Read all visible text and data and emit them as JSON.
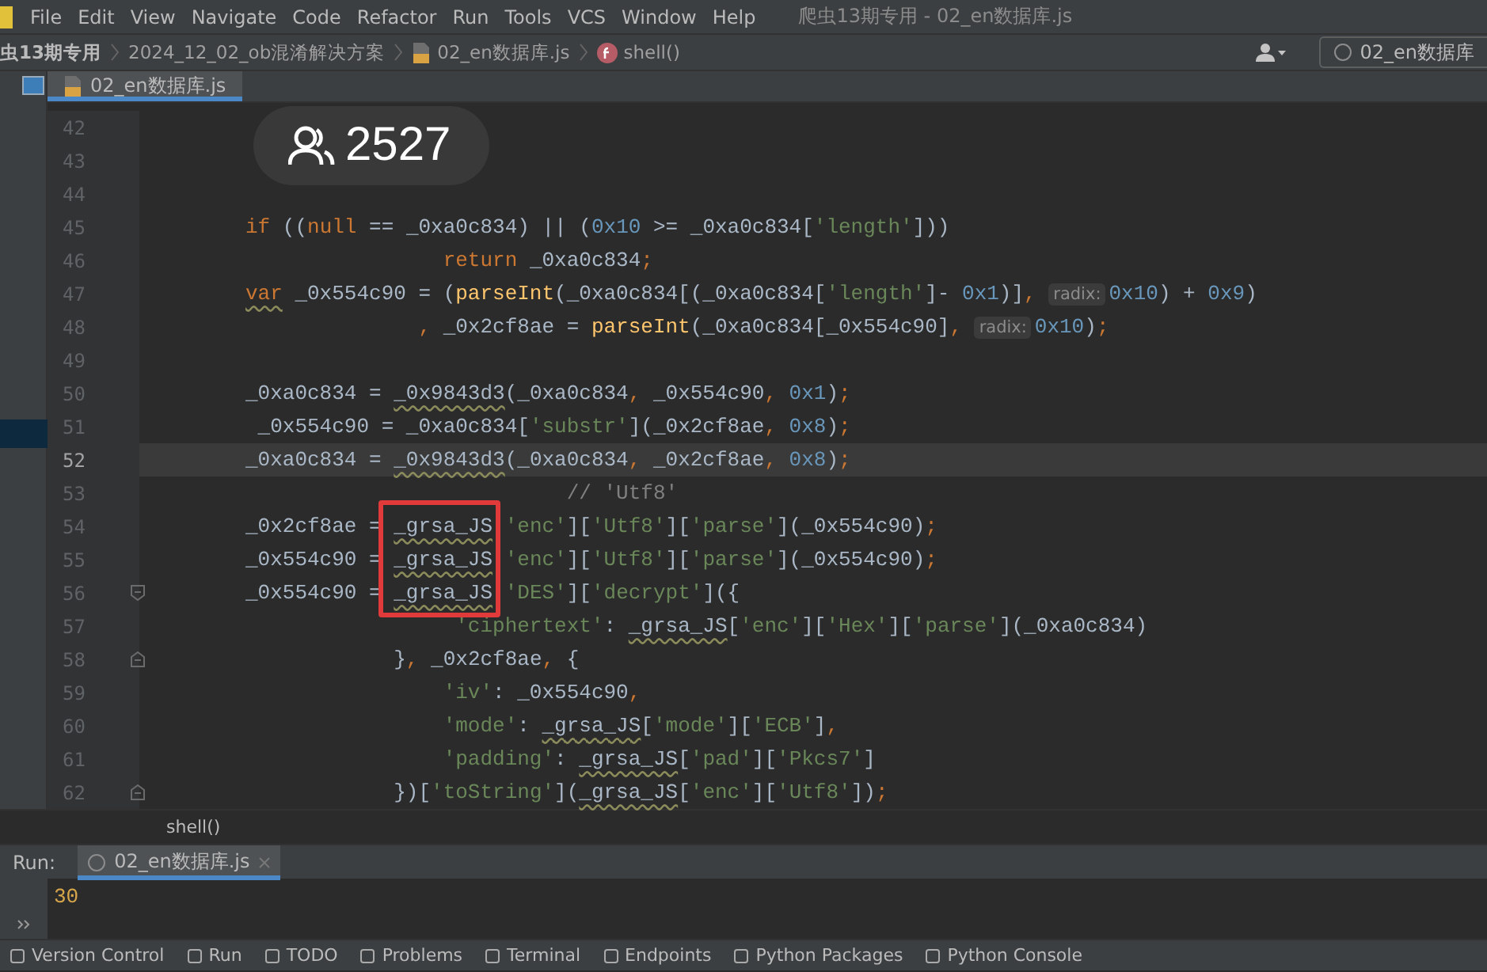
{
  "menu_bar": {
    "items": [
      "File",
      "Edit",
      "View",
      "Navigate",
      "Code",
      "Refactor",
      "Run",
      "Tools",
      "VCS",
      "Window",
      "Help"
    ],
    "title": "爬虫13期专用 - 02_en数据库.js"
  },
  "breadcrumbs": [
    {
      "kind": "project",
      "text": "虫13期专用"
    },
    {
      "kind": "folder",
      "text": "2024_12_02_ob混淆解决方案"
    },
    {
      "kind": "file",
      "text": "02_en数据库.js"
    },
    {
      "kind": "function",
      "text": "shell()"
    }
  ],
  "run_config": {
    "label": "02_en数据库"
  },
  "editor_tabs": [
    {
      "label": "02_en数据库.js",
      "selected": true
    }
  ],
  "viewer_badge": {
    "count": "2527"
  },
  "lines": [
    {
      "number": "42",
      "kind": "code",
      "current": false
    },
    {
      "number": "43",
      "kind": "code",
      "current": false
    },
    {
      "number": "44",
      "kind": "code",
      "current": false
    },
    {
      "number": "45",
      "kind": "code",
      "current": false,
      "tokens": [
        {
          "kind": "keyword",
          "text": "if"
        },
        {
          "kind": "plain",
          "text": " (("
        },
        {
          "kind": "keyword",
          "text": "null"
        },
        {
          "kind": "plain",
          "text": " == _0xa0c834) || ("
        },
        {
          "kind": "number",
          "text": "0x10"
        },
        {
          "kind": "plain",
          "text": " >= _0xa0c834["
        },
        {
          "kind": "string",
          "text": "'length'"
        },
        {
          "kind": "plain",
          "text": "]))"
        }
      ]
    },
    {
      "number": "46",
      "kind": "code",
      "current": false,
      "tokens": [
        {
          "kind": "keyword",
          "text": "                return"
        },
        {
          "kind": "plain",
          "text": " _0xa0c834"
        },
        {
          "kind": "punct",
          "text": ";"
        }
      ]
    },
    {
      "number": "47",
      "kind": "code",
      "current": false,
      "tokens": [
        {
          "kind": "keyword-warn",
          "text": "var"
        },
        {
          "kind": "plain",
          "text": " _0x554c90 = ("
        },
        {
          "kind": "function",
          "text": "parseInt"
        },
        {
          "kind": "plain",
          "text": "(_0xa0c834[(_0xa0c834["
        },
        {
          "kind": "string",
          "text": "'length'"
        },
        {
          "kind": "plain",
          "text": "]- "
        },
        {
          "kind": "number",
          "text": "0x1"
        },
        {
          "kind": "plain",
          "text": ")]"
        },
        {
          "kind": "punct",
          "text": ", "
        },
        {
          "kind": "hint",
          "text": "radix:"
        },
        {
          "kind": "number",
          "text": "0x10"
        },
        {
          "kind": "plain",
          "text": ") + "
        },
        {
          "kind": "number",
          "text": "0x9"
        },
        {
          "kind": "plain",
          "text": ")"
        }
      ]
    },
    {
      "number": "48",
      "kind": "code",
      "current": false,
      "tokens": [
        {
          "kind": "punct",
          "text": "              ,"
        },
        {
          "kind": "plain",
          "text": " _0x2cf8ae = "
        },
        {
          "kind": "function",
          "text": "parseInt"
        },
        {
          "kind": "plain",
          "text": "(_0xa0c834[_0x554c90]"
        },
        {
          "kind": "punct",
          "text": ", "
        },
        {
          "kind": "hint",
          "text": "radix:"
        },
        {
          "kind": "number",
          "text": "0x10"
        },
        {
          "kind": "plain",
          "text": ")"
        },
        {
          "kind": "punct",
          "text": ";"
        }
      ]
    },
    {
      "number": "49",
      "kind": "code",
      "current": false
    },
    {
      "number": "50",
      "kind": "code",
      "current": false,
      "tokens": [
        {
          "kind": "plain",
          "text": "_0xa0c834 = "
        },
        {
          "kind": "warn",
          "text": "_0x9843d3"
        },
        {
          "kind": "plain",
          "text": "(_0xa0c834"
        },
        {
          "kind": "punct",
          "text": ","
        },
        {
          "kind": "plain",
          "text": " _0x554c90"
        },
        {
          "kind": "punct",
          "text": ","
        },
        {
          "kind": "number",
          "text": " 0x1"
        },
        {
          "kind": "plain",
          "text": ")"
        },
        {
          "kind": "punct",
          "text": ";"
        }
      ]
    },
    {
      "number": "51",
      "kind": "code",
      "current": false,
      "tokens": [
        {
          "kind": "plain",
          "text": " _0x554c90 = _0xa0c834["
        },
        {
          "kind": "string",
          "text": "'substr'"
        },
        {
          "kind": "plain",
          "text": "](_0x2cf8ae"
        },
        {
          "kind": "punct",
          "text": ","
        },
        {
          "kind": "number",
          "text": " 0x8"
        },
        {
          "kind": "plain",
          "text": ")"
        },
        {
          "kind": "punct",
          "text": ";"
        }
      ]
    },
    {
      "number": "52",
      "kind": "code",
      "current": true,
      "tokens": [
        {
          "kind": "plain",
          "text": "_0xa0c834 = "
        },
        {
          "kind": "warn",
          "text": "_0x9843d3"
        },
        {
          "kind": "plain",
          "text": "(_0xa0c834"
        },
        {
          "kind": "punct",
          "text": ","
        },
        {
          "kind": "plain",
          "text": " _0x2cf8ae"
        },
        {
          "kind": "punct",
          "text": ","
        },
        {
          "kind": "number",
          "text": " 0x8"
        },
        {
          "kind": "plain",
          "text": ")"
        },
        {
          "kind": "punct",
          "text": ";"
        }
      ]
    },
    {
      "number": "53",
      "kind": "code",
      "current": false,
      "tokens": [
        {
          "kind": "comment",
          "text": "                          // 'Utf8'"
        }
      ]
    },
    {
      "number": "54",
      "kind": "code",
      "current": false,
      "tokens": [
        {
          "kind": "plain",
          "text": "_0x2cf8ae = "
        },
        {
          "kind": "warn",
          "text": "_grsa_JS"
        },
        {
          "kind": "string",
          "text": " 'enc'"
        },
        {
          "kind": "plain",
          "text": "]["
        },
        {
          "kind": "string",
          "text": "'Utf8'"
        },
        {
          "kind": "plain",
          "text": "]["
        },
        {
          "kind": "string",
          "text": "'parse'"
        },
        {
          "kind": "plain",
          "text": "](_0x554c90)"
        },
        {
          "kind": "punct",
          "text": ";"
        }
      ]
    },
    {
      "number": "55",
      "kind": "code",
      "current": false,
      "tokens": [
        {
          "kind": "plain",
          "text": "_0x554c90 = "
        },
        {
          "kind": "warn",
          "text": "_grsa_JS"
        },
        {
          "kind": "string",
          "text": " 'enc'"
        },
        {
          "kind": "plain",
          "text": "]["
        },
        {
          "kind": "string",
          "text": "'Utf8'"
        },
        {
          "kind": "plain",
          "text": "]["
        },
        {
          "kind": "string",
          "text": "'parse'"
        },
        {
          "kind": "plain",
          "text": "](_0x554c90)"
        },
        {
          "kind": "punct",
          "text": ";"
        }
      ]
    },
    {
      "number": "56",
      "kind": "foldstart",
      "current": false,
      "tokens": [
        {
          "kind": "plain",
          "text": "_0x554c90 = "
        },
        {
          "kind": "warn",
          "text": "_grsa_JS"
        },
        {
          "kind": "string",
          "text": " 'DES'"
        },
        {
          "kind": "plain",
          "text": "]["
        },
        {
          "kind": "string",
          "text": "'decrypt'"
        },
        {
          "kind": "plain",
          "text": "]({"
        }
      ]
    },
    {
      "number": "57",
      "kind": "code",
      "current": false,
      "tokens": [
        {
          "kind": "string",
          "text": "                 'ciphertext'"
        },
        {
          "kind": "plain",
          "text": ": "
        },
        {
          "kind": "warn",
          "text": "_grsa_JS"
        },
        {
          "kind": "plain",
          "text": "["
        },
        {
          "kind": "string",
          "text": "'enc'"
        },
        {
          "kind": "plain",
          "text": "]["
        },
        {
          "kind": "string",
          "text": "'Hex'"
        },
        {
          "kind": "plain",
          "text": "]["
        },
        {
          "kind": "string",
          "text": "'parse'"
        },
        {
          "kind": "plain",
          "text": "](_0xa0c834)"
        }
      ]
    },
    {
      "number": "58",
      "kind": "foldend",
      "current": false,
      "tokens": [
        {
          "kind": "plain",
          "text": "            }"
        },
        {
          "kind": "punct",
          "text": ","
        },
        {
          "kind": "plain",
          "text": " _0x2cf8ae"
        },
        {
          "kind": "punct",
          "text": ","
        },
        {
          "kind": "plain",
          "text": " {"
        }
      ]
    },
    {
      "number": "59",
      "kind": "code",
      "current": false,
      "tokens": [
        {
          "kind": "string",
          "text": "                'iv'"
        },
        {
          "kind": "plain",
          "text": ": _0x554c90"
        },
        {
          "kind": "punct",
          "text": ","
        }
      ]
    },
    {
      "number": "60",
      "kind": "code",
      "current": false,
      "tokens": [
        {
          "kind": "string",
          "text": "                'mode'"
        },
        {
          "kind": "plain",
          "text": ": "
        },
        {
          "kind": "warn",
          "text": "_grsa_JS"
        },
        {
          "kind": "plain",
          "text": "["
        },
        {
          "kind": "string",
          "text": "'mode'"
        },
        {
          "kind": "plain",
          "text": "]["
        },
        {
          "kind": "string",
          "text": "'ECB'"
        },
        {
          "kind": "plain",
          "text": "]"
        },
        {
          "kind": "punct",
          "text": ","
        }
      ]
    },
    {
      "number": "61",
      "kind": "code",
      "current": false,
      "tokens": [
        {
          "kind": "string",
          "text": "                'padding'"
        },
        {
          "kind": "plain",
          "text": ": "
        },
        {
          "kind": "warn",
          "text": "_grsa_JS"
        },
        {
          "kind": "plain",
          "text": "["
        },
        {
          "kind": "string",
          "text": "'pad'"
        },
        {
          "kind": "plain",
          "text": "]["
        },
        {
          "kind": "string",
          "text": "'Pkcs7'"
        },
        {
          "kind": "plain",
          "text": "]"
        }
      ]
    },
    {
      "number": "62",
      "kind": "foldend",
      "current": false,
      "tokens": [
        {
          "kind": "plain",
          "text": "            })["
        },
        {
          "kind": "string",
          "text": "'toString'"
        },
        {
          "kind": "plain",
          "text": "]("
        },
        {
          "kind": "warn",
          "text": "_grsa_JS"
        },
        {
          "kind": "plain",
          "text": "["
        },
        {
          "kind": "string",
          "text": "'enc'"
        },
        {
          "kind": "plain",
          "text": "]["
        },
        {
          "kind": "string",
          "text": "'Utf8'"
        },
        {
          "kind": "plain",
          "text": "])"
        },
        {
          "kind": "punct",
          "text": ";"
        }
      ]
    }
  ],
  "structure_breadcrumb": "shell()",
  "run_panel": {
    "label": "Run:",
    "tabs": [
      {
        "label": "02_en数据库.js",
        "selected": true
      }
    ],
    "output": [
      "30"
    ]
  },
  "tool_windows": [
    "Version Control",
    "Run",
    "TODO",
    "Problems",
    "Terminal",
    "Endpoints",
    "Python Packages",
    "Python Console"
  ]
}
